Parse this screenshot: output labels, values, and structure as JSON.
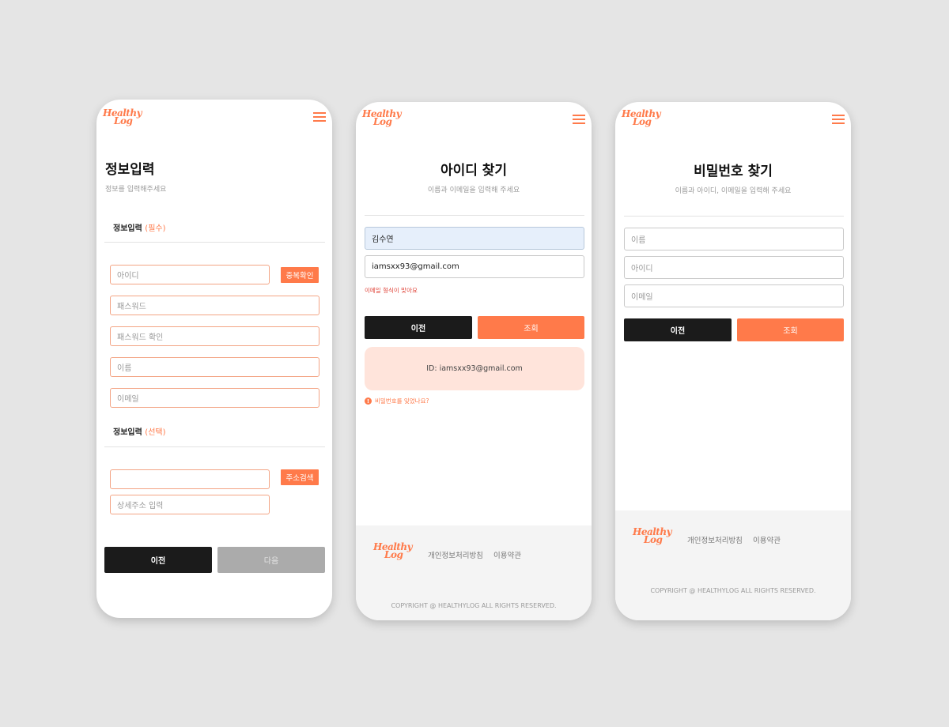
{
  "logo": {
    "line1": "Healthy",
    "line2": "Log"
  },
  "screen1": {
    "title": "정보입력",
    "subtitle": "정보를 입력해주세요",
    "required_label": "정보입력",
    "required_tag": "(필수)",
    "fields": {
      "id": "아이디",
      "password": "패스워드",
      "password_confirm": "패스워드 확인",
      "name": "이름",
      "email": "이메일"
    },
    "dup_check_button": "중복확인",
    "optional_label": "정보입력",
    "optional_tag": "(선택)",
    "address_value": "",
    "address_search_button": "주소검색",
    "address_detail_placeholder": "상세주소 입력",
    "prev_button": "이전",
    "next_button": "다음"
  },
  "screen2": {
    "title": "아이디 찾기",
    "subtitle": "이름과 이메일을 입력해 주세요",
    "name_value": "김수연",
    "email_value": "iamsxx93@gmail.com",
    "error_text": "이메일 형식이 맞아요",
    "prev_button": "이전",
    "search_button": "조회",
    "result_text": "ID: iamsxx93@gmail.com",
    "forgot_password_link": "비밀번호를 잊었나요?",
    "footer_privacy": "개인정보처리방침",
    "footer_terms": "이용약관",
    "footer_copyright": "COPYRIGHT @ HEALTHYLOG ALL RIGHTS RESERVED."
  },
  "screen3": {
    "title": "비밀번호 찾기",
    "subtitle": "이름과 아이디, 이메일을 입력해 주세요",
    "fields": {
      "name": "이름",
      "id": "아이디",
      "email": "이메일"
    },
    "prev_button": "이전",
    "search_button": "조회",
    "footer_privacy": "개인정보처리방침",
    "footer_terms": "이용약관",
    "footer_copyright": "COPYRIGHT @ HEALTHYLOG ALL RIGHTS RESERVED."
  },
  "colors": {
    "accent": "#ff7a4a",
    "dark": "#1b1b1b",
    "result_bg": "#ffe4db"
  }
}
